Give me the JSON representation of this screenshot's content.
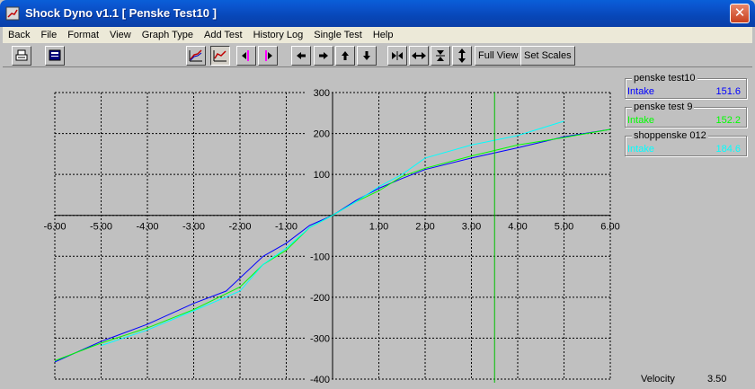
{
  "window": {
    "title": "Shock Dyno v1.1  [ Penske Test10 ]",
    "close_glyph": "✕"
  },
  "menu": [
    "Back",
    "File",
    "Format",
    "View",
    "Graph Type",
    "Add Test",
    "History Log",
    "Single Test",
    "Help"
  ],
  "toolbar": {
    "full_view_label": "Full View",
    "set_scales_label": "Set Scales",
    "icons": [
      "printer-icon",
      "monitor-icon",
      "force-velocity-graph-icon",
      "force-velocity-curve-icon",
      "cursor-left-icon",
      "cursor-right-icon",
      "pan-left-icon",
      "pan-right-icon",
      "pan-up-icon",
      "pan-down-icon",
      "compress-horizontal-icon",
      "expand-horizontal-icon",
      "compress-vertical-icon",
      "expand-vertical-icon"
    ]
  },
  "legend": [
    {
      "title": "penske test10",
      "name": "Intake",
      "value": "151.6",
      "color": "#0000ff"
    },
    {
      "title": "penske test 9",
      "name": "Intake",
      "value": "152.2",
      "color": "#00ff00"
    },
    {
      "title": "shoppenske 012",
      "name": "Intake",
      "value": "184.6",
      "color": "#00ffff"
    }
  ],
  "status": {
    "velocity_label": "Velocity",
    "velocity_value": "3.50"
  },
  "chart_data": {
    "type": "line",
    "xlim": [
      -6,
      6
    ],
    "ylim": [
      -400,
      300
    ],
    "x_ticks": [
      "-6.00",
      "-5.00",
      "-4.00",
      "-3.00",
      "-2.00",
      "-1.00",
      "1.00",
      "2.00",
      "3.00",
      "4.00",
      "5.00",
      "6.00"
    ],
    "y_ticks": [
      "300",
      "200",
      "100",
      "-100",
      "-200",
      "-300",
      "-400"
    ],
    "grid": true,
    "cursor_x": 3.5,
    "cursor_color": "#00c000",
    "series": [
      {
        "name": "penske test10",
        "color": "#0000ff",
        "x": [
          -6,
          -5,
          -4,
          -3,
          -2.3,
          -1.5,
          -1,
          -0.5,
          0,
          0.5,
          1,
          1.5,
          2,
          3,
          4,
          5,
          6
        ],
        "y": [
          -358,
          -308,
          -266,
          -215,
          -185,
          -100,
          -68,
          -25,
          0,
          36,
          66,
          90,
          112,
          140,
          165,
          192,
          210
        ]
      },
      {
        "name": "penske test 9",
        "color": "#00ff00",
        "x": [
          -6,
          -5,
          -4,
          -3,
          -2,
          -1.5,
          -1,
          -0.5,
          0,
          0.5,
          1,
          1.5,
          2,
          3,
          4,
          5,
          6
        ],
        "y": [
          -355,
          -312,
          -275,
          -230,
          -175,
          -120,
          -85,
          -30,
          0,
          33,
          60,
          95,
          115,
          145,
          172,
          190,
          210
        ]
      },
      {
        "name": "shoppenske 012",
        "color": "#00ffff",
        "x": [
          -5,
          -4,
          -3,
          -2,
          -1.5,
          -1,
          -0.5,
          0,
          0.5,
          1,
          1.5,
          2,
          3,
          4,
          5
        ],
        "y": [
          -318,
          -280,
          -233,
          -185,
          -120,
          -80,
          -30,
          0,
          33,
          70,
          100,
          140,
          172,
          195,
          230
        ]
      }
    ]
  }
}
